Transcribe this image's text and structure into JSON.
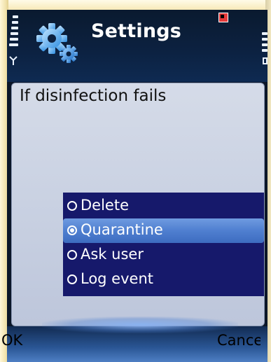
{
  "header": {
    "title": "Settings",
    "icon": "gear-icon",
    "badge_icon": "app-badge-icon"
  },
  "dialog": {
    "prompt": "If disinfection fails",
    "options": [
      {
        "label": "Delete",
        "selected": false
      },
      {
        "label": "Quarantine",
        "selected": true
      },
      {
        "label": "Ask user",
        "selected": false
      },
      {
        "label": "Log event",
        "selected": false
      }
    ]
  },
  "softkeys": {
    "left": "OK",
    "right": "Cancel"
  },
  "colors": {
    "options_bg": "#16196b",
    "selection": "#4f7fd0",
    "badge": "#e53a3a"
  }
}
